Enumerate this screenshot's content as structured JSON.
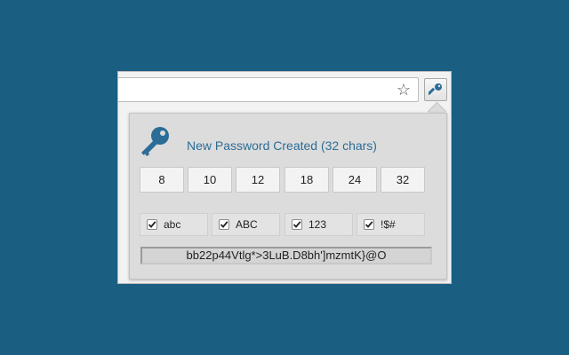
{
  "popup": {
    "title": "New Password Created (32 chars)",
    "lengths": [
      "8",
      "10",
      "12",
      "18",
      "24",
      "32"
    ],
    "options": [
      {
        "label": "abc",
        "checked": true
      },
      {
        "label": "ABC",
        "checked": true
      },
      {
        "label": "123",
        "checked": true
      },
      {
        "label": "!$#",
        "checked": true
      }
    ],
    "password": "bb22p44Vtlg*>3LuB.D8bh']mzmtK}@O"
  },
  "colors": {
    "background": "#1a5e82",
    "accent": "#2b6d96"
  },
  "icons": {
    "bookmark": "star-icon",
    "extension": "key-icon"
  }
}
